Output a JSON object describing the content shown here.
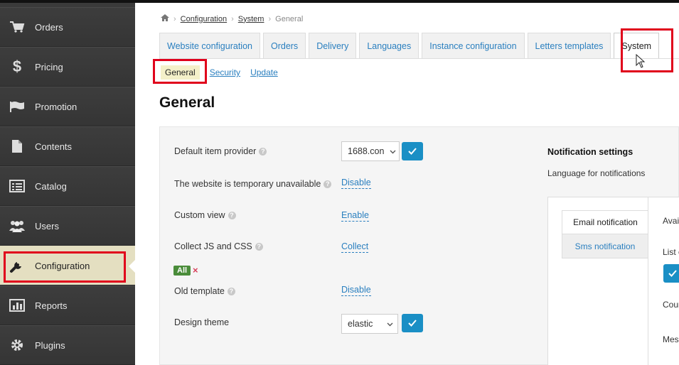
{
  "sidebar": {
    "items": [
      {
        "label": "Orders",
        "icon": "cart-icon"
      },
      {
        "label": "Pricing",
        "icon": "dollar-icon"
      },
      {
        "label": "Promotion",
        "icon": "flag-icon"
      },
      {
        "label": "Contents",
        "icon": "document-icon"
      },
      {
        "label": "Catalog",
        "icon": "list-icon"
      },
      {
        "label": "Users",
        "icon": "users-icon"
      },
      {
        "label": "Configuration",
        "icon": "wrench-icon",
        "active": true
      },
      {
        "label": "Reports",
        "icon": "bar-chart-icon"
      },
      {
        "label": "Plugins",
        "icon": "gear-icon"
      }
    ]
  },
  "breadcrumb": {
    "home_icon": "home-icon",
    "items": [
      "Configuration",
      "System",
      "General"
    ]
  },
  "tabs": [
    "Website configuration",
    "Orders",
    "Delivery",
    "Languages",
    "Instance configuration",
    "Letters templates",
    "System"
  ],
  "active_tab": "System",
  "subtabs": [
    "General",
    "Security",
    "Update"
  ],
  "active_subtab": "General",
  "page_title": "General",
  "settings": {
    "default_item_provider": {
      "label": "Default item provider",
      "value": "1688.con"
    },
    "website_unavailable": {
      "label": "The website is temporary unavailable",
      "action": "Disable"
    },
    "custom_view": {
      "label": "Custom view",
      "action": "Enable"
    },
    "collect_js_css": {
      "label": "Collect JS and CSS",
      "action": "Collect",
      "badge": "All",
      "remove": "×"
    },
    "old_template": {
      "label": "Old template",
      "action": "Disable"
    },
    "design_theme": {
      "label": "Design theme",
      "value": "elastic"
    }
  },
  "notifications": {
    "title": "Notification settings",
    "language_label": "Language for notifications",
    "tabs": [
      "Email notification",
      "Sms notification"
    ],
    "right_labels": [
      "Avail",
      "List o",
      "Cour",
      "Mess"
    ]
  },
  "colors": {
    "accent_blue": "#1a8fc5",
    "link_blue": "#2a7fbf",
    "highlight_red": "#e0001b",
    "active_sidebar": "#e4dfc1"
  }
}
